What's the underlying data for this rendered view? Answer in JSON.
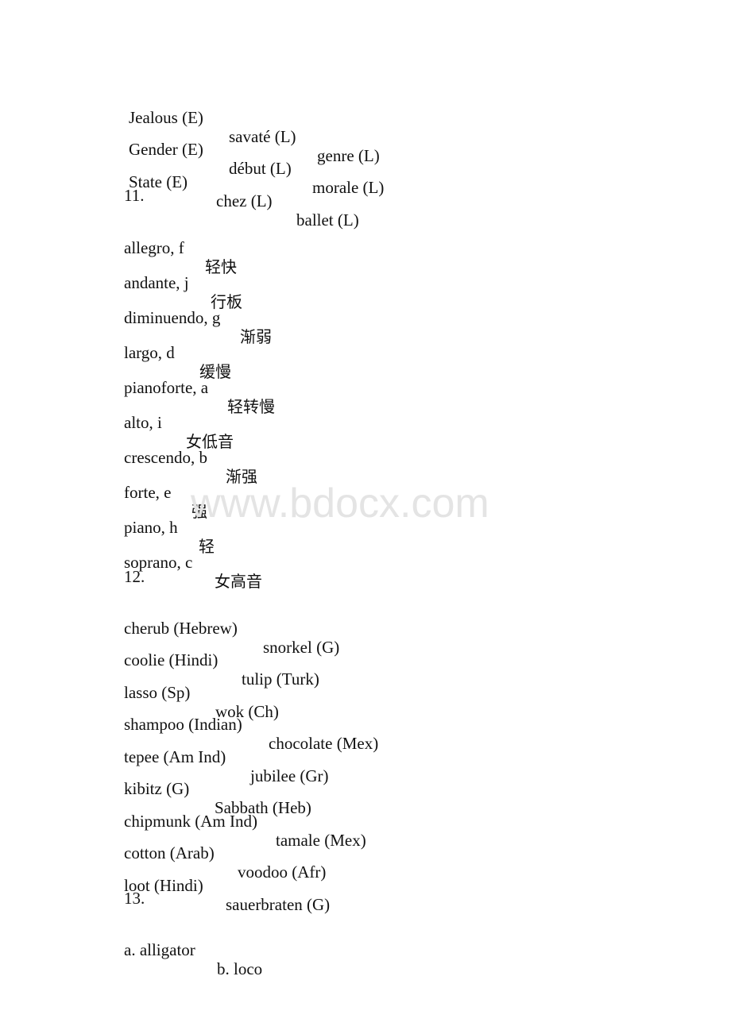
{
  "section10": {
    "rows": [
      [
        "Jealous (E)",
        "savaté (L)",
        "genre (L)"
      ],
      [
        "Gender (E)",
        "début (L)",
        "morale (L)"
      ],
      [
        "State (E)",
        "chez (L)",
        "ballet (L)"
      ]
    ]
  },
  "section11": {
    "number": "11.",
    "items": [
      {
        "term": "allegro, f",
        "meaning": "轻快"
      },
      {
        "term": "andante, j",
        "meaning": "行板"
      },
      {
        "term": "diminuendo, g",
        "meaning": "渐弱"
      },
      {
        "term": "largo, d",
        "meaning": "缓慢"
      },
      {
        "term": "pianoforte, a",
        "meaning": "轻转慢"
      },
      {
        "term": "alto, i",
        "meaning": "女低音"
      },
      {
        "term": "crescendo, b",
        "meaning": "渐强"
      },
      {
        "term": "forte, e",
        "meaning": "强"
      },
      {
        "term": "piano, h",
        "meaning": "轻"
      },
      {
        "term": "soprano, c",
        "meaning": "女高音"
      }
    ]
  },
  "section12": {
    "number": "12.",
    "rows": [
      [
        "cherub (Hebrew)",
        "snorkel (G)"
      ],
      [
        "coolie (Hindi)",
        "tulip (Turk)"
      ],
      [
        "lasso (Sp)",
        "wok (Ch)"
      ],
      [
        "shampoo (Indian)",
        "chocolate (Mex)"
      ],
      [
        "tepee (Am Ind)",
        "jubilee (Gr)"
      ],
      [
        "kibitz (G)",
        "Sabbath (Heb)"
      ],
      [
        "chipmunk (Am Ind)",
        "tamale (Mex)"
      ],
      [
        "cotton (Arab)",
        "voodoo (Afr)"
      ],
      [
        "loot (Hindi)",
        "sauerbraten (G)"
      ]
    ]
  },
  "section13": {
    "number": "13.",
    "items": [
      "a. alligator",
      "b. loco"
    ]
  },
  "watermark": {
    "text": "www.bdocx.com",
    "color": "#e4e4e4"
  }
}
